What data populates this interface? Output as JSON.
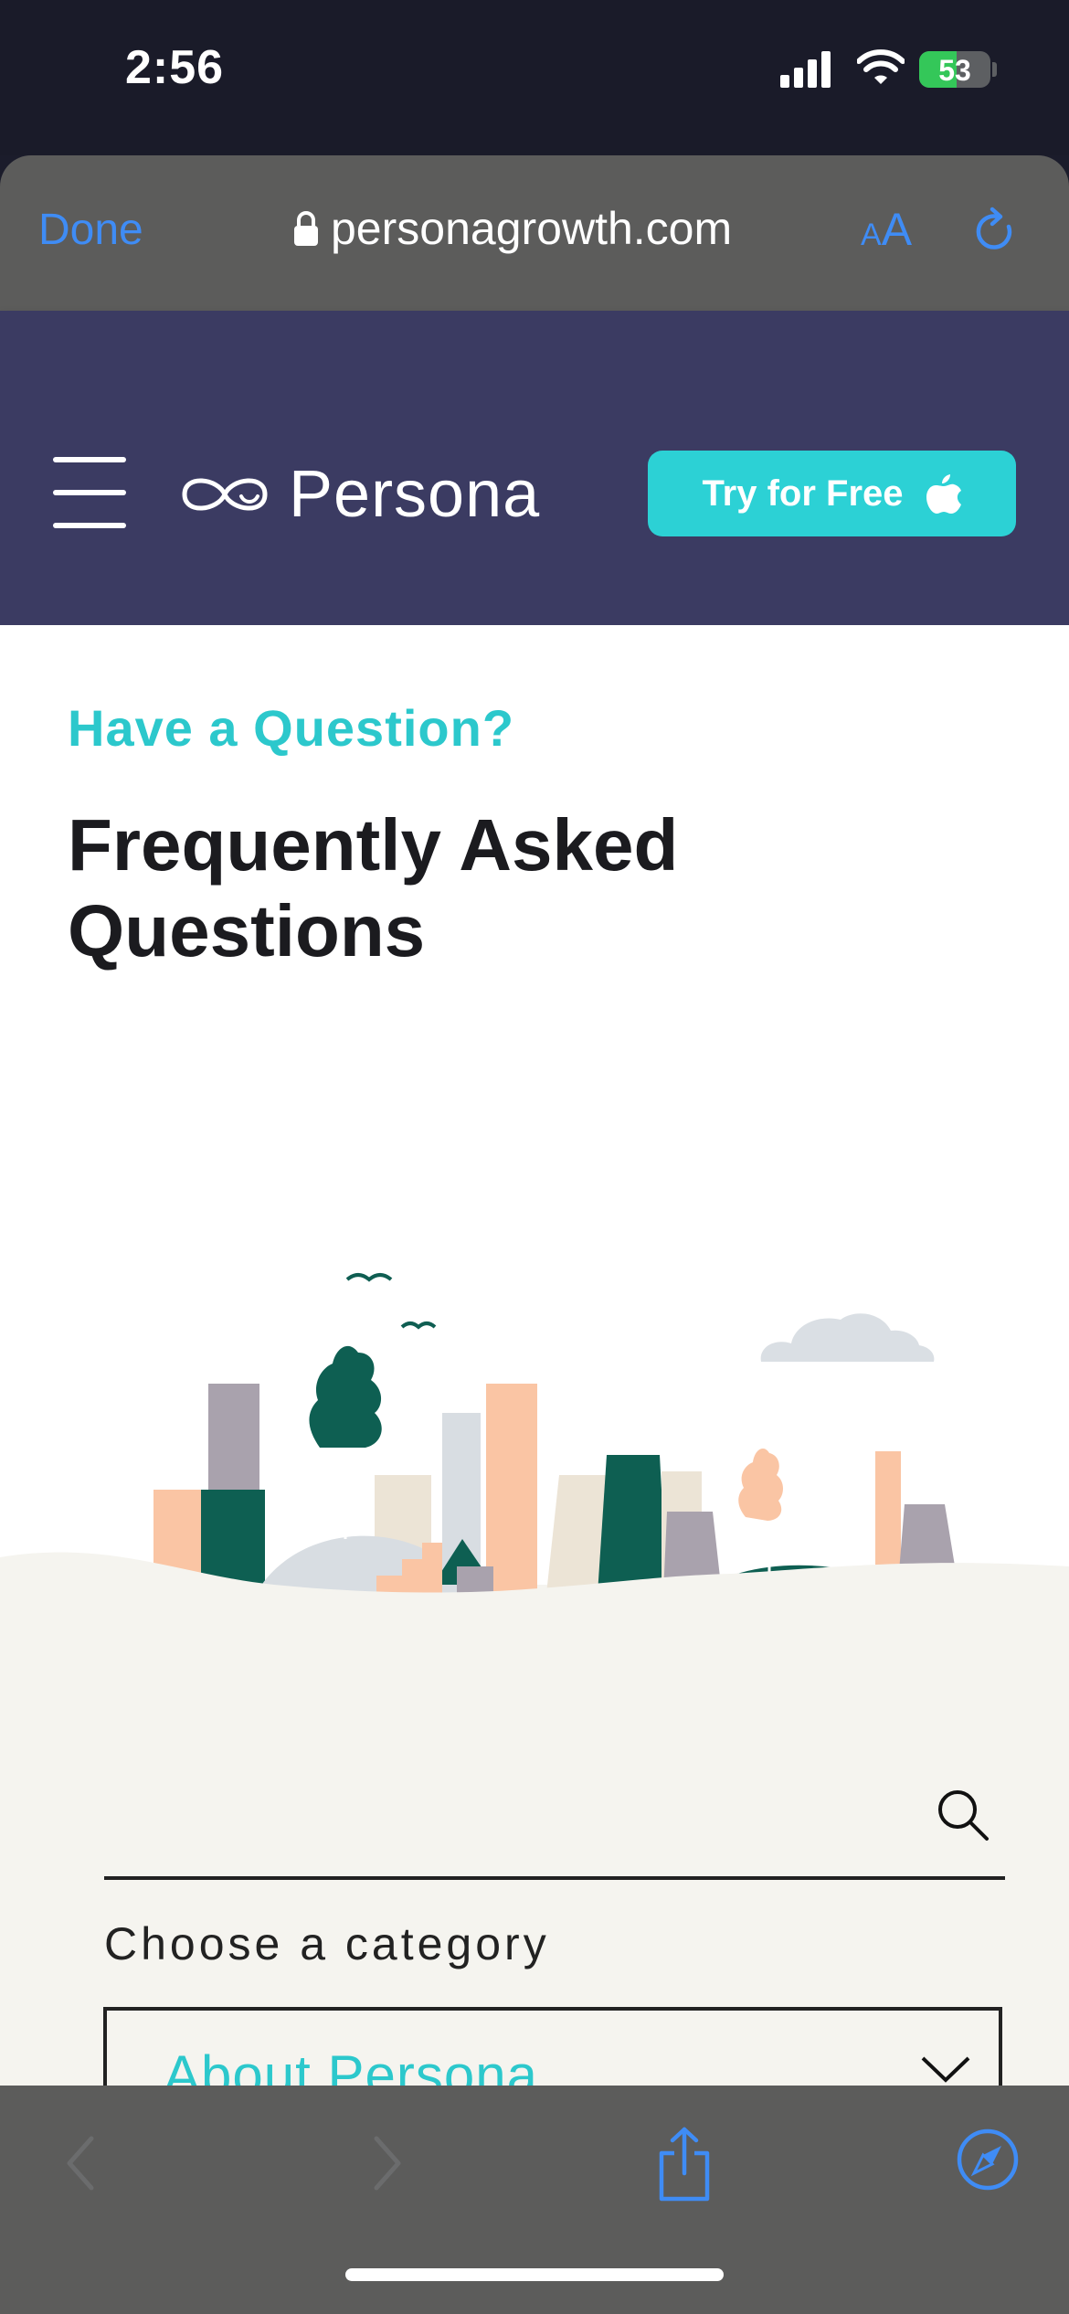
{
  "status_bar": {
    "time": "2:56",
    "battery_level": "53",
    "battery_fraction": 0.53,
    "charging": true
  },
  "browser": {
    "done_label": "Done",
    "url": "personagrowth.com",
    "reader_small": "A",
    "reader_large": "A",
    "accent_color": "#3f8cf5"
  },
  "site_header": {
    "brand_name": "Persona",
    "cta_label": "Try for Free",
    "bg_color": "#3b3b62",
    "cta_color": "#2cd1d5"
  },
  "hero": {
    "eyebrow": "Have a Question?",
    "title": "Frequently Asked Questions"
  },
  "faq": {
    "choose_label": "Choose a category",
    "selected_category": "About Persona"
  },
  "icons": {
    "lock": "lock-icon",
    "reload": "reload-icon",
    "menu": "hamburger-icon",
    "logo": "persona-logo-icon",
    "apple": "apple-icon",
    "search": "search-icon",
    "chevron": "chevron-down-icon",
    "back": "back-icon",
    "forward": "forward-icon",
    "share": "share-icon",
    "compass": "compass-icon"
  }
}
